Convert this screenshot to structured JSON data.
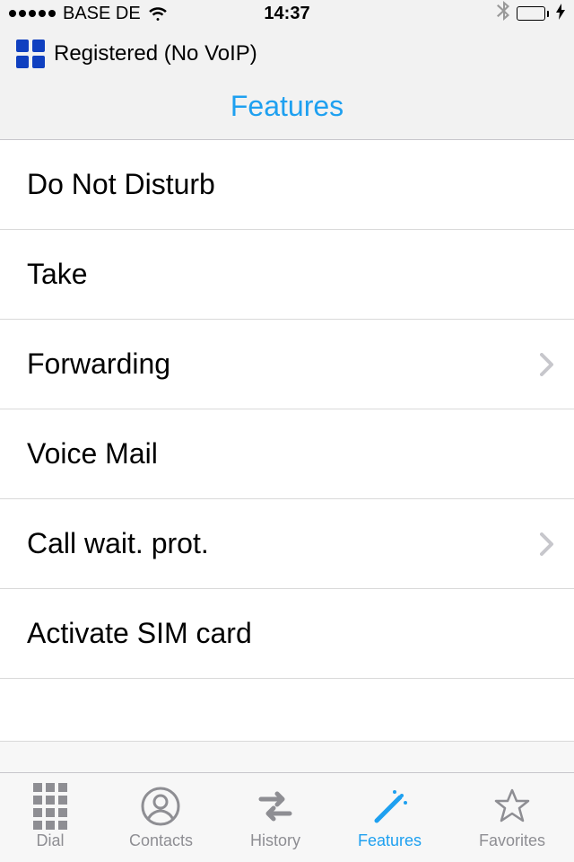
{
  "status": {
    "carrier": "BASE DE",
    "time": "14:37"
  },
  "header": {
    "registered": "Registered (No VoIP)",
    "title": "Features"
  },
  "features": [
    {
      "label": "Do Not Disturb",
      "chevron": false
    },
    {
      "label": "Take",
      "chevron": false
    },
    {
      "label": "Forwarding",
      "chevron": true
    },
    {
      "label": "Voice Mail",
      "chevron": false
    },
    {
      "label": "Call wait. prot.",
      "chevron": true
    },
    {
      "label": "Activate SIM card",
      "chevron": false
    }
  ],
  "tabs": [
    {
      "label": "Dial"
    },
    {
      "label": "Contacts"
    },
    {
      "label": "History"
    },
    {
      "label": "Features"
    },
    {
      "label": "Favorites"
    }
  ],
  "active_tab": "Features",
  "colors": {
    "accent": "#1ea0f0"
  }
}
